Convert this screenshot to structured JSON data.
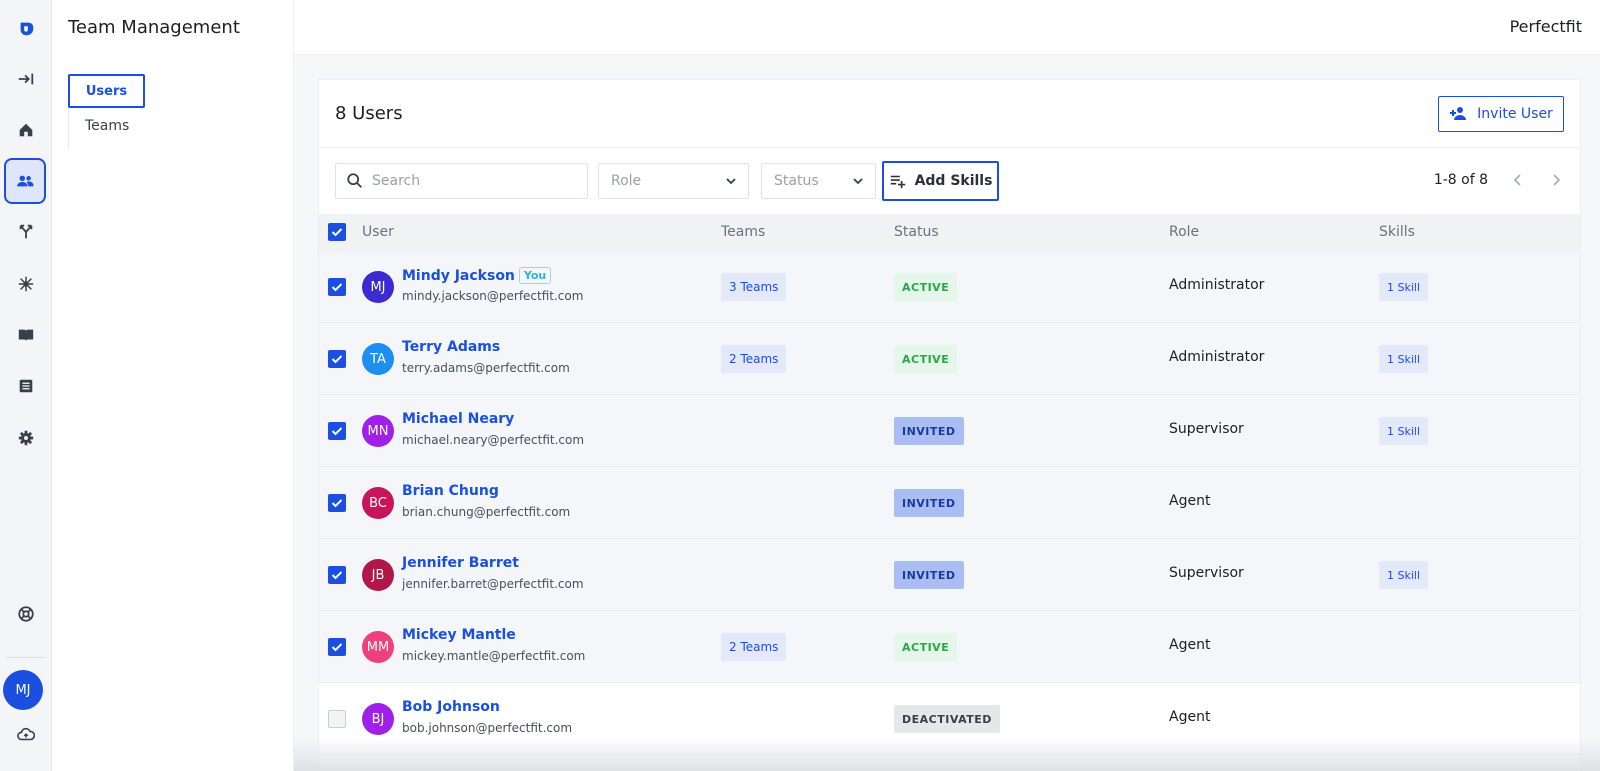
{
  "app": {
    "brand": "Perfectfit",
    "section_title": "Team Management"
  },
  "sidebar": {
    "items": [
      {
        "label": "Users",
        "active": true
      },
      {
        "label": "Teams",
        "active": false
      }
    ]
  },
  "rail": {
    "icons": [
      "logo-icon",
      "expand-icon",
      "home-icon",
      "users-icon",
      "routing-icon",
      "integrations-icon",
      "book-icon",
      "list-icon",
      "settings-icon",
      "help-icon",
      "cloud-icon"
    ],
    "user_initials": "MJ",
    "accent": "#1a4fe0"
  },
  "users_panel": {
    "count_label": "8 Users",
    "invite_label": "Invite User",
    "search_placeholder": "Search",
    "role_placeholder": "Role",
    "status_placeholder": "Status",
    "add_skills_label": "Add Skills",
    "pagination": "1-8 of 8"
  },
  "table": {
    "columns": [
      "User",
      "Teams",
      "Status",
      "Role",
      "Skills"
    ],
    "rows": [
      {
        "initials": "MJ",
        "avatar_color": "#3b2bd0",
        "name": "Mindy Jackson",
        "you": "You",
        "email": "mindy.jackson@perfectfit.com",
        "teams": "3 Teams",
        "status": "ACTIVE",
        "role": "Administrator",
        "skills": "1 Skill",
        "checked": true
      },
      {
        "initials": "TA",
        "avatar_color": "#1e8ef0",
        "name": "Terry Adams",
        "you": "",
        "email": "terry.adams@perfectfit.com",
        "teams": "2 Teams",
        "status": "ACTIVE",
        "role": "Administrator",
        "skills": "1 Skill",
        "checked": true
      },
      {
        "initials": "MN",
        "avatar_color": "#a020e8",
        "name": "Michael Neary",
        "you": "",
        "email": "michael.neary@perfectfit.com",
        "teams": "",
        "status": "INVITED",
        "role": "Supervisor",
        "skills": "1 Skill",
        "checked": true
      },
      {
        "initials": "BC",
        "avatar_color": "#c8145a",
        "name": "Brian Chung",
        "you": "",
        "email": "brian.chung@perfectfit.com",
        "teams": "",
        "status": "INVITED",
        "role": "Agent",
        "skills": "",
        "checked": true
      },
      {
        "initials": "JB",
        "avatar_color": "#b01848",
        "name": "Jennifer Barret",
        "you": "",
        "email": "jennifer.barret@perfectfit.com",
        "teams": "",
        "status": "INVITED",
        "role": "Supervisor",
        "skills": "1 Skill",
        "checked": true
      },
      {
        "initials": "MM",
        "avatar_color": "#f0407a",
        "name": "Mickey Mantle",
        "you": "",
        "email": "mickey.mantle@perfectfit.com",
        "teams": "2 Teams",
        "status": "ACTIVE",
        "role": "Agent",
        "skills": "",
        "checked": true
      },
      {
        "initials": "BJ",
        "avatar_color": "#a020e8",
        "name": "Bob Johnson",
        "you": "",
        "email": "bob.johnson@perfectfit.com",
        "teams": "",
        "status": "DEACTIVATED",
        "role": "Agent",
        "skills": "",
        "checked": false
      }
    ]
  }
}
